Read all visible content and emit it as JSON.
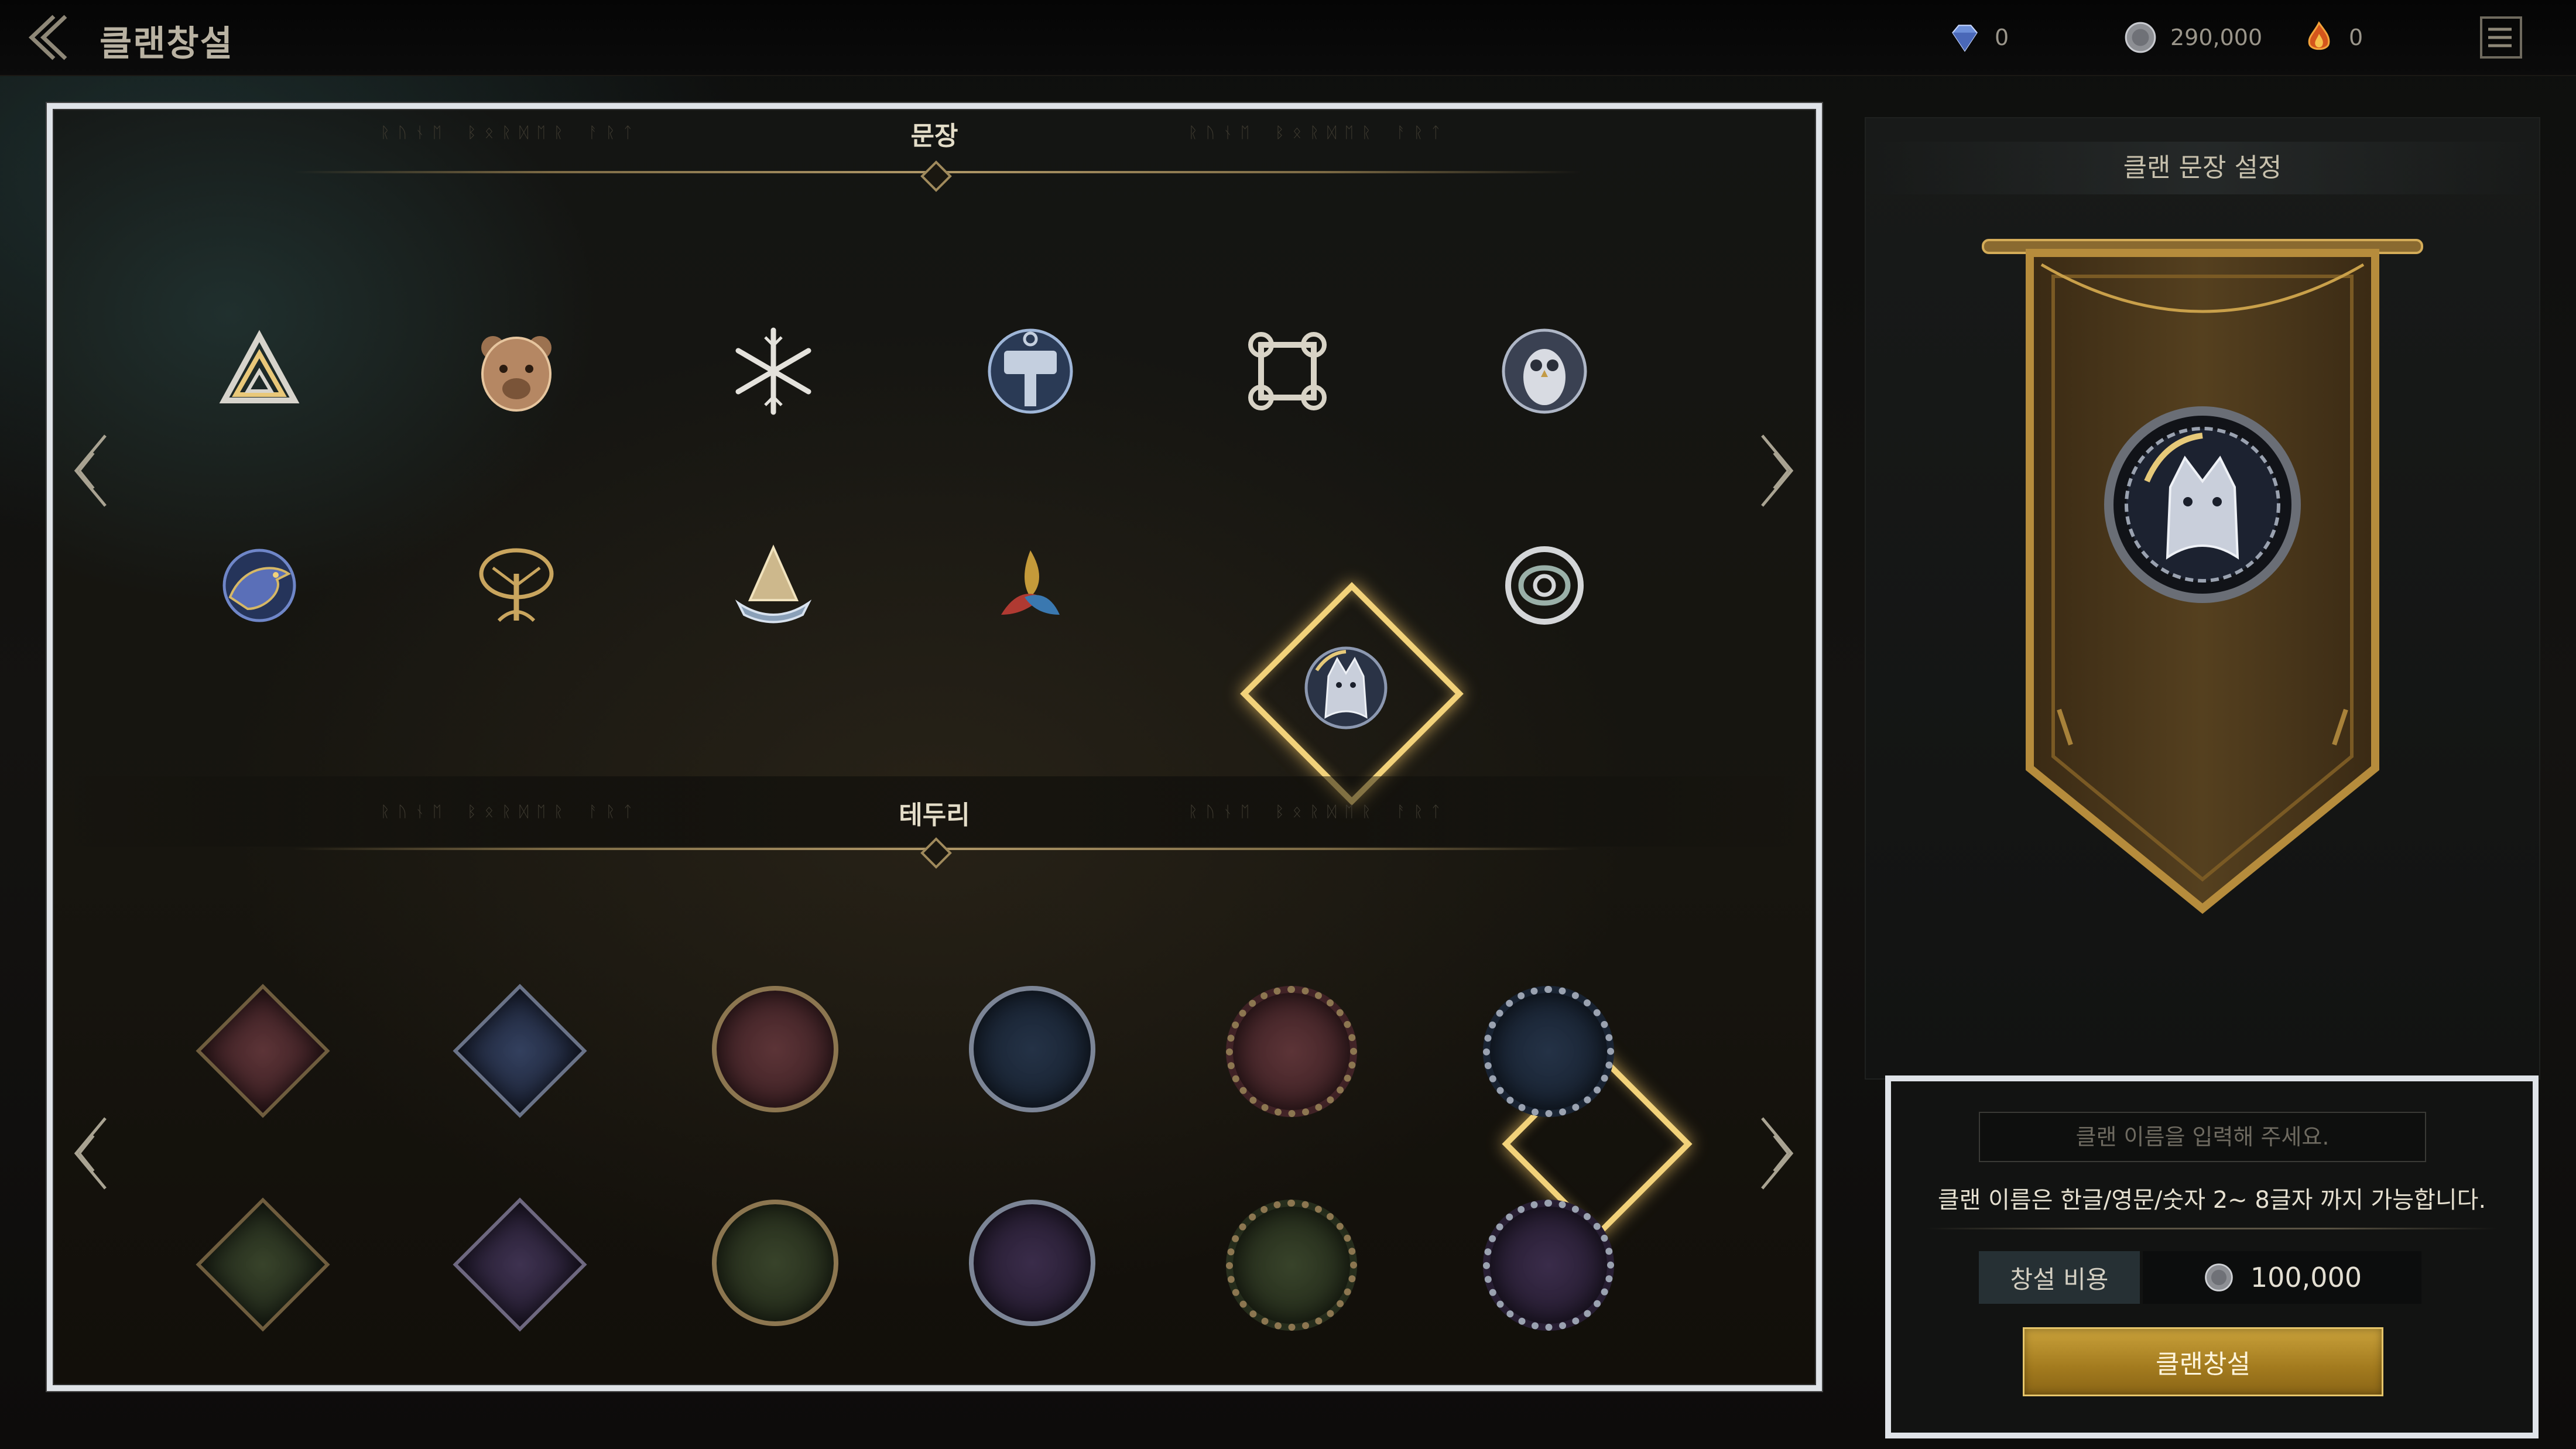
{
  "header": {
    "title": "클랜창설",
    "currencies": [
      {
        "icon": "diamond-gem-icon",
        "value": "0"
      },
      {
        "icon": "silver-coin-icon",
        "value": "290,000"
      },
      {
        "icon": "fire-gem-icon",
        "value": "0"
      }
    ]
  },
  "emblem_section": {
    "title": "문장",
    "emblems": [
      {
        "name": "valknut-emblem",
        "selected": false
      },
      {
        "name": "bear-emblem",
        "selected": false
      },
      {
        "name": "snowflake-rune-emblem",
        "selected": false
      },
      {
        "name": "mjolnir-emblem",
        "selected": false
      },
      {
        "name": "knot-square-emblem",
        "selected": false
      },
      {
        "name": "owl-emblem",
        "selected": false
      },
      {
        "name": "raven-emblem",
        "selected": false
      },
      {
        "name": "yggdrasil-tree-emblem",
        "selected": false
      },
      {
        "name": "longship-emblem",
        "selected": false
      },
      {
        "name": "triskelion-horns-emblem",
        "selected": false
      },
      {
        "name": "wolf-emblem",
        "selected": true
      },
      {
        "name": "serpent-knot-emblem",
        "selected": false
      }
    ]
  },
  "border_section": {
    "title": "테두리",
    "borders": [
      {
        "shape": "diamond",
        "color": "#4a2a2c",
        "selected": false
      },
      {
        "shape": "diamond",
        "color": "#26314a",
        "selected": false
      },
      {
        "shape": "circle-gold",
        "color": "#4a2a2c",
        "selected": false
      },
      {
        "shape": "circle-silver",
        "color": "#1e2a38",
        "selected": false
      },
      {
        "shape": "circle-rope-gold",
        "color": "#4a2a2c",
        "selected": false
      },
      {
        "shape": "circle-rope-silver",
        "color": "#1e2a38",
        "selected": true
      },
      {
        "shape": "diamond",
        "color": "#2c3420",
        "selected": false
      },
      {
        "shape": "diamond",
        "color": "#322840",
        "selected": false
      },
      {
        "shape": "circle-gold",
        "color": "#2c3420",
        "selected": false
      },
      {
        "shape": "circle-silver",
        "color": "#2c2236",
        "selected": false
      },
      {
        "shape": "circle-rope-gold",
        "color": "#2c3420",
        "selected": false
      },
      {
        "shape": "circle-rope-silver",
        "color": "#2c2236",
        "selected": false
      }
    ]
  },
  "preview": {
    "title": "클랜 문장 설정"
  },
  "form": {
    "name_placeholder": "클랜 이름을 입력해 주세요.",
    "rule_text": "클랜 이름은 한글/영문/숫자 2~ 8글자 까지 가능합니다.",
    "cost_label": "창설 비용",
    "cost_value": "100,000",
    "create_button": "클랜창설"
  },
  "colors": {
    "accent_gold": "#f2d27a",
    "button_gold": "#b08424",
    "frame": "#dfe3e8"
  }
}
